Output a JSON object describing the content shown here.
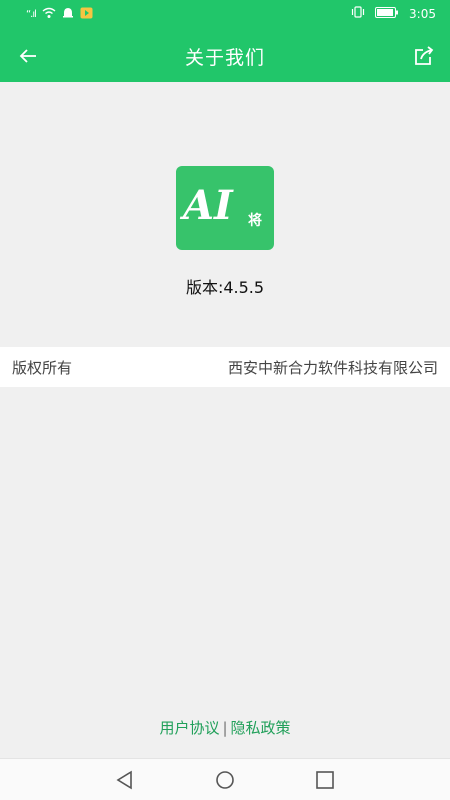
{
  "status_bar": {
    "time": "3:05"
  },
  "app_bar": {
    "title": "关于我们",
    "back_icon": "arrow-left-icon",
    "share_icon": "share-icon"
  },
  "logo": {
    "text": "AI",
    "sub": "将"
  },
  "version": {
    "text": "版本:4.5.5"
  },
  "copyright": {
    "label": "版权所有",
    "value": "西安中新合力软件科技有限公司"
  },
  "footer_links": {
    "user_agreement": "用户协议",
    "separator": "|",
    "privacy_policy": "隐私政策"
  },
  "colors": {
    "accent": "#21c66a",
    "logo_bg": "#37c36b",
    "link": "#21a05a"
  }
}
